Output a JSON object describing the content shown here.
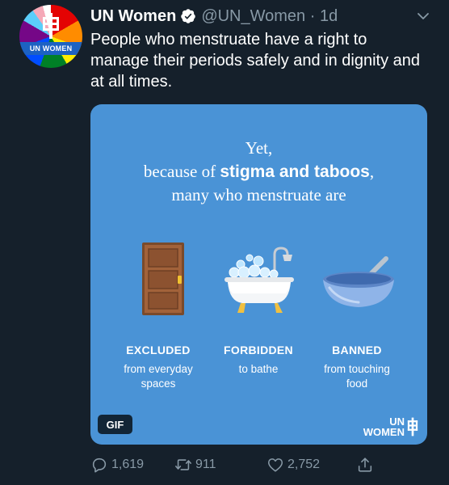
{
  "tweet": {
    "author_name": "UN Women",
    "handle_time": "@UN_Women · 1d",
    "text": "People who menstruate have a right to manage their periods safely and in dignity and at all times."
  },
  "avatar": {
    "band_text": "UN WOMEN"
  },
  "media": {
    "headline_line1": "Yet,",
    "headline_line2_prefix": "because of ",
    "headline_line2_bold": "stigma and taboos",
    "headline_line2_suffix": ",",
    "headline_line3": "many who menstruate are",
    "items": [
      {
        "label": "EXCLUDED",
        "desc_line1": "from everyday",
        "desc_line2": "spaces",
        "emoji": "door"
      },
      {
        "label": "FORBIDDEN",
        "desc_line1": "to bathe",
        "desc_line2": "",
        "emoji": "bathtub"
      },
      {
        "label": "BANNED",
        "desc_line1": "from touching",
        "desc_line2": "food",
        "emoji": "bowl-with-spoon"
      }
    ],
    "gif_badge": "GIF",
    "logo_line1": "UN",
    "logo_line2": "WOMEN"
  },
  "actions": {
    "reply_count": "1,619",
    "retweet_count": "911",
    "like_count": "2,752"
  },
  "colors": {
    "background": "#15202b",
    "card": "#4a93d6",
    "muted": "#8899a6",
    "verified": "#ffffff"
  }
}
